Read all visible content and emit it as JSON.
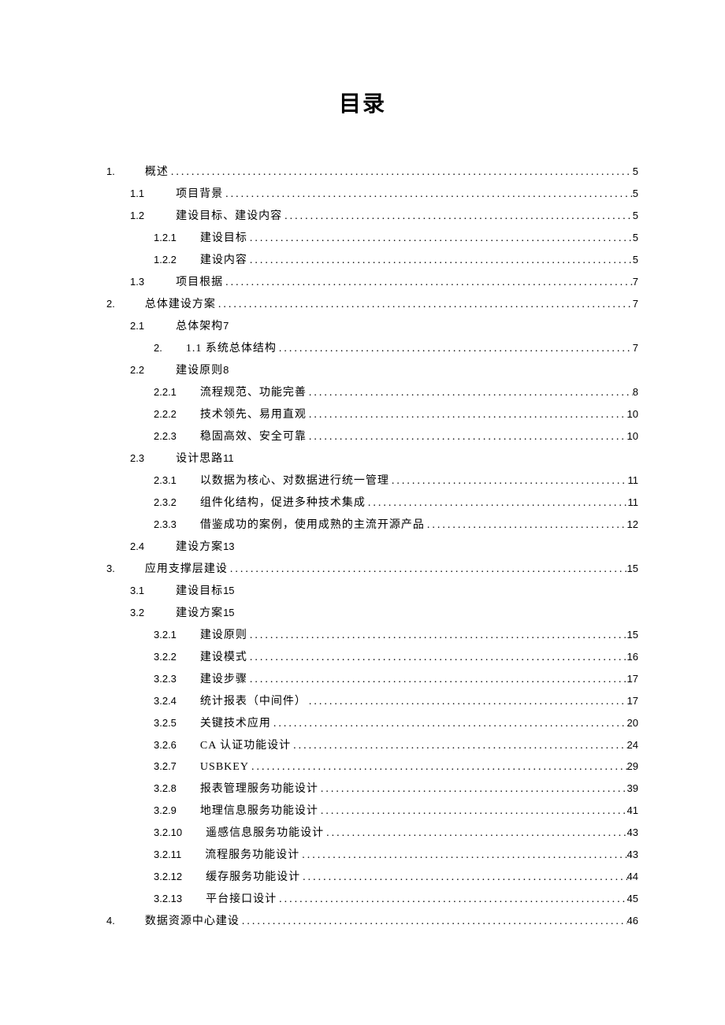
{
  "title": "目录",
  "toc": [
    {
      "level": 1,
      "num": "1.",
      "text": "概述",
      "page": "5"
    },
    {
      "level": 2,
      "num": "1.1",
      "text": "项目背景",
      "page": "5"
    },
    {
      "level": 2,
      "num": "1.2",
      "text": "建设目标、建设内容",
      "page": "5"
    },
    {
      "level": 3,
      "num": "1.2.1",
      "text": "建设目标",
      "page": "5"
    },
    {
      "level": 3,
      "num": "1.2.2",
      "text": "建设内容",
      "page": "5"
    },
    {
      "level": 2,
      "num": "1.3",
      "text": "项目根据",
      "page": "7"
    },
    {
      "level": 1,
      "num": "2.",
      "text": "总体建设方案",
      "page": "7"
    },
    {
      "level": 2,
      "num": "2.1",
      "text": "总体架构",
      "inline_page": "7",
      "no_dots": true
    },
    {
      "level": 3,
      "num": "2.",
      "text": "1.1 系统总体结构",
      "page": "7"
    },
    {
      "level": 2,
      "num": "2.2",
      "text": "建设原则",
      "inline_page": "8",
      "no_dots": true
    },
    {
      "level": 3,
      "num": "2.2.1",
      "text": "流程规范、功能完善",
      "page": "8"
    },
    {
      "level": 3,
      "num": "2.2.2",
      "text": "技术领先、易用直观",
      "page": "10"
    },
    {
      "level": 3,
      "num": "2.2.3",
      "text": "稳固高效、安全可靠",
      "page": "10"
    },
    {
      "level": 2,
      "num": "2.3",
      "text": "设计思路",
      "inline_page": "11",
      "no_dots": true
    },
    {
      "level": 3,
      "num": "2.3.1",
      "text": "以数据为核心、对数据进行统一管理",
      "page": "11"
    },
    {
      "level": 3,
      "num": "2.3.2",
      "text": "组件化结构，促进多种技术集成",
      "page": "11"
    },
    {
      "level": 3,
      "num": "2.3.3",
      "text": "借鉴成功的案例，使用成熟的主流开源产品",
      "page": "12"
    },
    {
      "level": 2,
      "num": "2.4",
      "text": "建设方案",
      "inline_page": "13",
      "no_dots": true
    },
    {
      "level": 1,
      "num": "3.",
      "text": "应用支撑层建设",
      "page": "15"
    },
    {
      "level": 2,
      "num": "3.1",
      "text": "建设目标",
      "inline_page": "15",
      "no_dots": true
    },
    {
      "level": 2,
      "num": "3.2",
      "text": "建设方案",
      "inline_page": "15",
      "no_dots": true
    },
    {
      "level": 3,
      "num": "3.2.1",
      "text": "建设原则",
      "page": "15"
    },
    {
      "level": 3,
      "num": "3.2.2",
      "text": "建设模式",
      "page": "16"
    },
    {
      "level": 3,
      "num": "3.2.3",
      "text": "建设步骤",
      "page": "17"
    },
    {
      "level": 3,
      "num": "3.2.4",
      "text": "统计报表（中间件）",
      "page": "17"
    },
    {
      "level": 3,
      "num": "3.2.5",
      "text": "关键技术应用",
      "page": "20"
    },
    {
      "level": 3,
      "num": "3.2.6",
      "text": "CA 认证功能设计",
      "page": "24"
    },
    {
      "level": 3,
      "num": "3.2.7",
      "text": "USBKEY",
      "page": "29",
      "tight": true
    },
    {
      "level": 3,
      "num": "3.2.8",
      "text": "报表管理服务功能设计",
      "page": "39"
    },
    {
      "level": 3,
      "num": "3.2.9",
      "text": "地理信息服务功能设计",
      "page": "41"
    },
    {
      "level": 3,
      "num": "3.2.10",
      "text": "遥感信息服务功能设计",
      "page": "43"
    },
    {
      "level": 3,
      "num": "3.2.11",
      "text": "流程服务功能设计",
      "page": "43"
    },
    {
      "level": 3,
      "num": "3.2.12",
      "text": "缓存服务功能设计",
      "page": "44"
    },
    {
      "level": 3,
      "num": "3.2.13",
      "text": "平台接口设计",
      "page": "45"
    },
    {
      "level": 1,
      "num": "4.",
      "text": "数据资源中心建设",
      "page": "46"
    }
  ]
}
